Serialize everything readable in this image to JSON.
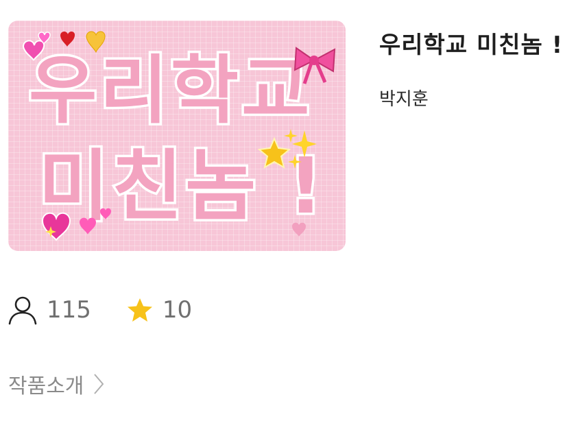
{
  "cover": {
    "line1": "우리학교",
    "line2": "미친놈 !"
  },
  "work": {
    "title": "우리학교 미친놈 !",
    "author": "박지훈"
  },
  "stats": {
    "views": "115",
    "views_icon": "person-icon",
    "rating": "10",
    "rating_icon": "star-icon",
    "star_color": "#f7c21a"
  },
  "intro": {
    "label": "작품소개",
    "icon": "chevron-right-icon"
  }
}
